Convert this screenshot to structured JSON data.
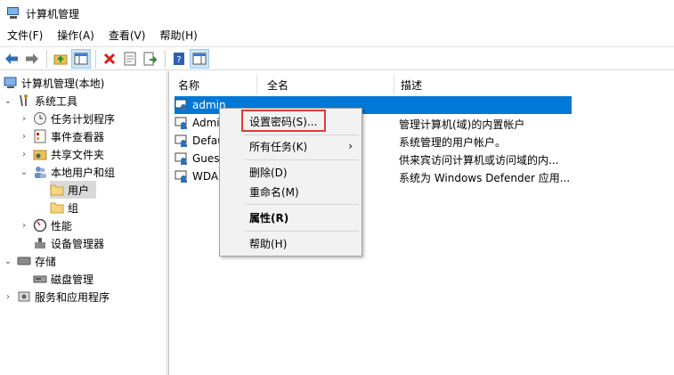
{
  "window": {
    "title": "计算机管理"
  },
  "menubar": [
    "文件(F)",
    "操作(A)",
    "查看(V)",
    "帮助(H)"
  ],
  "toolbar": [
    "back-arrow-icon",
    "forward-arrow-icon",
    "up-folder-icon",
    "show-hide-tree-icon",
    "delete-icon",
    "properties-icon",
    "export-list-icon",
    "help-icon",
    "action-pane-icon"
  ],
  "tree": {
    "root": "计算机管理(本地)",
    "system_tools": "系统工具",
    "task_scheduler": "任务计划程序",
    "event_viewer": "事件查看器",
    "shared_folders": "共享文件夹",
    "local_users_groups": "本地用户和组",
    "users": "用户",
    "groups": "组",
    "performance": "性能",
    "device_manager": "设备管理器",
    "storage": "存储",
    "disk_management": "磁盘管理",
    "services_apps": "服务和应用程序"
  },
  "columns": {
    "name": "名称",
    "fullname": "全名",
    "description": "描述"
  },
  "users": [
    {
      "name": "admin",
      "desc": ""
    },
    {
      "name": "Admi",
      "desc": "管理计算机(域)的内置帐户"
    },
    {
      "name": "Defau",
      "desc": "系统管理的用户帐户。"
    },
    {
      "name": "Guest",
      "desc": "供来宾访问计算机或访问域的内..."
    },
    {
      "name": "WDA",
      "desc": "系统为 Windows Defender 应用..."
    }
  ],
  "context_menu": {
    "set_password": "设置密码(S)...",
    "all_tasks": "所有任务(K)",
    "all_tasks_arrow": "›",
    "delete": "删除(D)",
    "rename": "重命名(M)",
    "properties": "属性(R)",
    "help": "帮助(H)"
  },
  "colors": {
    "selection": "#0078d7",
    "highlight_box": "#e33b3b"
  }
}
